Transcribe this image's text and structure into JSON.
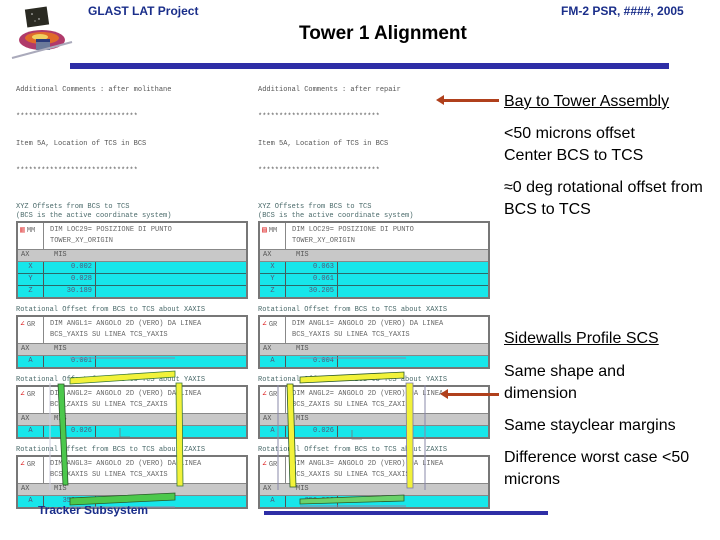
{
  "header": {
    "project": "GLAST LAT Project",
    "doc_ref": "FM-2 PSR, ####, 2005",
    "title": "Tower 1 Alignment",
    "logo_icon": "glast-satellite-logo"
  },
  "left_report": {
    "comment_lines": [
      "Additional Comments : after molithane",
      "*****************************",
      "Item 5A, Location of TCS in BCS",
      "*****************************"
    ],
    "blocks": [
      {
        "caption": [
          "XYZ Offsets from BCS to TCS",
          "(BCS is the active coordinate system)"
        ],
        "icon_glyph": "▥",
        "unit": "MM",
        "desc": [
          "DIM LOC29= POSIZIONE DI PUNTO",
          "TOWER_XY_ORIGIN"
        ],
        "col_ax": "AX",
        "col_meas": "MIS",
        "rows": [
          {
            "axis": "X",
            "value": "0.002"
          },
          {
            "axis": "Y",
            "value": "0.028"
          },
          {
            "axis": "Z",
            "value": "30.189"
          }
        ]
      },
      {
        "caption": [
          "Rotational Offset from BCS to TCS about XAXIS"
        ],
        "icon_glyph": "∠",
        "unit": "GR",
        "desc": [
          "DIM ANGL1= ANGOLO 2D (VERO) DA LINEA",
          "BCS_YAXIS SU LINEA TCS_YAXIS"
        ],
        "col_ax": "AX",
        "col_meas": "MIS",
        "rows": [
          {
            "axis": "A",
            "value": "0.001"
          }
        ]
      },
      {
        "caption": [
          "Rotational Offset from BCS to TCS about YAXIS"
        ],
        "icon_glyph": "∠",
        "unit": "GR",
        "desc": [
          "DIM ANGL2= ANGOLO 2D (VERO) DA LINEA",
          "BCS_ZAXIS SU LINEA TCS_ZAXIS"
        ],
        "col_ax": "AX",
        "col_meas": "MIS",
        "rows": [
          {
            "axis": "A",
            "value": "0.026"
          }
        ]
      },
      {
        "caption": [
          "Rotational Offset from BCS to TCS about ZAXIS"
        ],
        "icon_glyph": "∠",
        "unit": "GR",
        "desc": [
          "DIM ANGL3= ANGOLO 2D (VERO) DA LINEA",
          "BCS_XAXIS SU LINEA TCS_XAXIS"
        ],
        "col_ax": "AX",
        "col_meas": "MIS",
        "rows": [
          {
            "axis": "A",
            "value": "359.999"
          }
        ]
      }
    ]
  },
  "right_report": {
    "comment_lines": [
      "Additional Comments : after repair",
      "*****************************",
      "Item 5A, Location of TCS in BCS",
      "*****************************"
    ],
    "blocks": [
      {
        "caption": [
          "XYZ Offsets from BCS to TCS",
          "(BCS is the active coordinate system)"
        ],
        "icon_glyph": "▤",
        "unit": "MM",
        "desc": [
          "DIM LOC29= POSIZIONE DI PUNTO",
          "TOWER_XY_ORIGIN"
        ],
        "col_ax": "AX",
        "col_meas": "MIS",
        "rows": [
          {
            "axis": "X",
            "value": "0.063"
          },
          {
            "axis": "Y",
            "value": "0.061"
          },
          {
            "axis": "Z",
            "value": "30.205"
          }
        ]
      },
      {
        "caption": [
          "Rotational Offset from BCS to TCS about XAXIS"
        ],
        "icon_glyph": "∠",
        "unit": "GR",
        "desc": [
          "DIM ANGL1= ANGOLO 2D (VERO) DA LINEA",
          "BCS_YAXIS SU LINEA TCS_YAXIS"
        ],
        "col_ax": "AX",
        "col_meas": "MIS",
        "rows": [
          {
            "axis": "A",
            "value": "0.004"
          }
        ]
      },
      {
        "caption": [
          "Rotational Offset from BCS to TCS about YAXIS"
        ],
        "icon_glyph": "∠",
        "unit": "GR",
        "desc": [
          "DIM ANGL2= ANGOLO 2D (VERO) DA LINEA",
          "BCS_ZAXIS SU LINEA TCS_ZAXIS"
        ],
        "col_ax": "AX",
        "col_meas": "MIS",
        "rows": [
          {
            "axis": "A",
            "value": "0.026"
          }
        ]
      },
      {
        "caption": [
          "Rotational Offset from BCS to TCS about ZAXIS"
        ],
        "icon_glyph": "∠",
        "unit": "GR",
        "desc": [
          "DIM ANGL3= ANGOLO 2D (VERO) DA LINEA",
          "BCS_XAXIS SU LINEA TCS_XAXIS"
        ],
        "col_ax": "AX",
        "col_meas": "MIS",
        "rows": [
          {
            "axis": "A",
            "value": "359.993"
          }
        ]
      }
    ]
  },
  "bullets_top": {
    "heading": "Bay to Tower Assembly",
    "items": [
      "<50 microns offset Center BCS to TCS",
      "≈0 deg rotational offset from BCS to TCS"
    ]
  },
  "bullets_bottom": {
    "heading": "Sidewalls Profile SCS",
    "items": [
      "Same shape and dimension",
      "Same stayclear margins",
      "Difference worst case <50 microns"
    ]
  },
  "footer": {
    "subsystem": "Tracker Subsystem"
  },
  "colors": {
    "accent_bar": "#2e2ea6",
    "header_text": "#1a2e8a",
    "arrow": "#b0401c",
    "table_row": "#17e6ea",
    "profile_yellow": "#f2f23a",
    "profile_green": "#4cc84c"
  }
}
